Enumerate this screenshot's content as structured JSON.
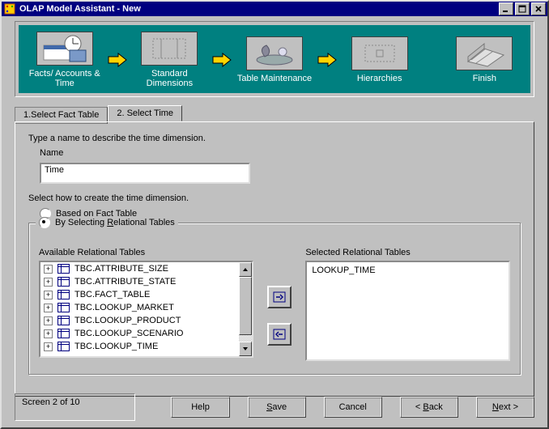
{
  "window": {
    "title": "OLAP Model Assistant - New"
  },
  "steps": [
    {
      "label": "Facts/ Accounts & Time"
    },
    {
      "label": "Standard Dimensions"
    },
    {
      "label": "Table Maintenance"
    },
    {
      "label": "Hierarchies"
    },
    {
      "label": "Finish"
    }
  ],
  "tabs": {
    "t1": "1.Select Fact Table",
    "t2": "2. Select Time"
  },
  "page": {
    "intro": "Type a name to describe the time dimension.",
    "name_label": "Name",
    "name_value": "Time",
    "select_how": "Select how to create the time dimension.",
    "opt_fact": "Based on Fact Table",
    "opt_rel": "By Selecting Relational Tables",
    "avail_label": "Available Relational Tables",
    "sel_label": "Selected Relational Tables",
    "available": [
      "TBC.ATTRIBUTE_SIZE",
      "TBC.ATTRIBUTE_STATE",
      "TBC.FACT_TABLE",
      "TBC.LOOKUP_MARKET",
      "TBC.LOOKUP_PRODUCT",
      "TBC.LOOKUP_SCENARIO",
      "TBC.LOOKUP_TIME"
    ],
    "selected": [
      "LOOKUP_TIME"
    ]
  },
  "footer": {
    "status": "Screen 2 of 10",
    "help": "Help",
    "save_pre": "",
    "save_u": "S",
    "save_post": "ave",
    "cancel": "Cancel",
    "back_pre": "< ",
    "back_u": "B",
    "back_post": "ack",
    "next_pre": "",
    "next_u": "N",
    "next_post": "ext >"
  }
}
